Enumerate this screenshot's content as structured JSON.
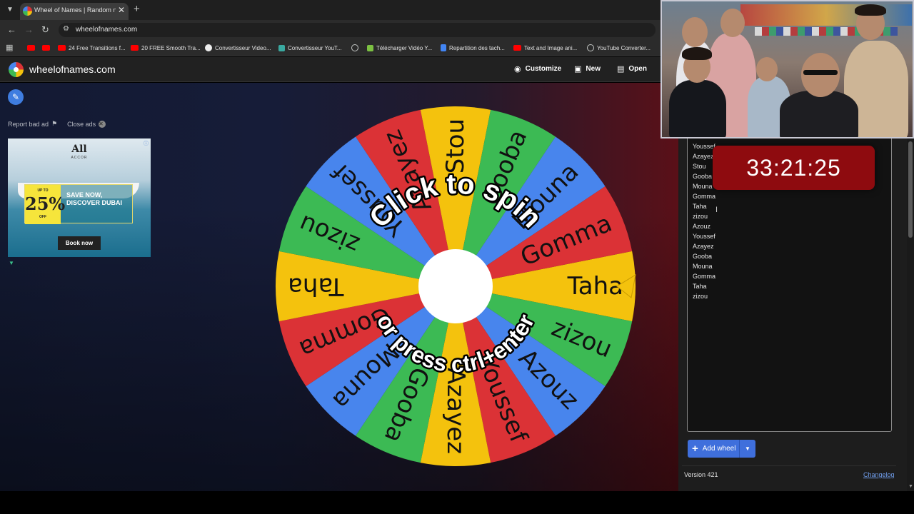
{
  "browser": {
    "tab_title": "Wheel of Names | Random nam",
    "url": "wheelofnames.com",
    "bookmarks": [
      {
        "label": "",
        "icon": "youtube-icon"
      },
      {
        "label": "",
        "icon": "youtube-icon"
      },
      {
        "label": "24 Free Transitions f...",
        "icon": "youtube-icon"
      },
      {
        "label": "20 FREE Smooth Tra...",
        "icon": "youtube-icon"
      },
      {
        "label": "Convertisseur Video...",
        "icon": "google-icon"
      },
      {
        "label": "Convertisseur YouT...",
        "icon": "converter-icon"
      },
      {
        "label": "",
        "icon": "globe-icon"
      },
      {
        "label": "Télécharger Vidéo Y...",
        "icon": "download-icon"
      },
      {
        "label": "Repartition des tach...",
        "icon": "doc-icon"
      },
      {
        "label": "Text and Image ani...",
        "icon": "youtube-icon"
      },
      {
        "label": "YouTube Converter...",
        "icon": "globe-icon"
      }
    ]
  },
  "header": {
    "site_name": "wheelofnames.com",
    "customize_label": "Customize",
    "new_label": "New",
    "open_label": "Open"
  },
  "sidebar": {
    "report_ad_label": "Report bad ad",
    "close_ads_label": "Close ads"
  },
  "ad": {
    "brand": "All",
    "brand_sub": "ACCOR",
    "up_to": "UP TO",
    "percent": "25%",
    "off": "OFF",
    "headline": "SAVE NOW, DISCOVER DUBAI",
    "cta": "Book now"
  },
  "wheel": {
    "entries": [
      "Taha",
      "zizou",
      "Azouz",
      "Youssef",
      "Azayez",
      "Gooba",
      "Mouna",
      "Gomma",
      "Taha",
      "zizou",
      "Youssef",
      "Azayez",
      "Stou",
      "Gooba",
      "Mouna",
      "Gomma"
    ],
    "segment_colors": [
      "#f4c20d",
      "#3cba54",
      "#4885ed",
      "#db3236"
    ],
    "center_color": "#ffffff",
    "pointer_color": "#f4c20d",
    "click_to_spin": "Click to spin",
    "press_hint": "or press ctrl+enter"
  },
  "names_panel": {
    "names": [
      "Youssef",
      "Azayez",
      "Stou",
      "Gooba",
      "Mouna",
      "Gomma",
      "Taha",
      "zizou",
      "Azouz",
      "Youssef",
      "Azayez",
      "Gooba",
      "Mouna",
      "Gomma",
      "Taha",
      "zizou"
    ],
    "timer": "33:21:25",
    "add_wheel_label": "Add wheel",
    "version": "Version 421",
    "changelog": "Changelog"
  }
}
